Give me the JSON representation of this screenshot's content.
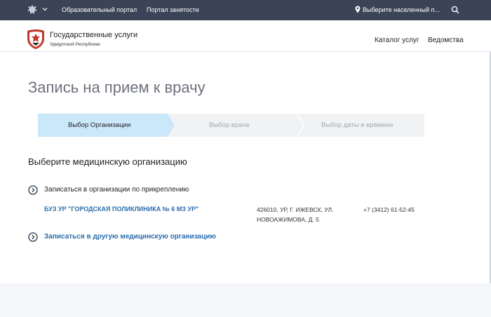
{
  "topbar": {
    "links": [
      "Образовательный портал",
      "Портал занятости"
    ],
    "location": "Выберите населенный п...",
    "icons": {
      "emblem": "coat-of-arms-icon",
      "location": "location-pin-icon",
      "search": "search-icon"
    }
  },
  "header": {
    "brand": "Государственные услуги",
    "region": "Удмуртской Республики",
    "nav": [
      "Каталог услуг",
      "Ведомства"
    ]
  },
  "page_title": "Запись на прием к врачу",
  "steps": [
    {
      "label": "Выбор Организации",
      "active": true
    },
    {
      "label": "Выбор врача",
      "active": false
    },
    {
      "label": "Выбор даты и времени",
      "active": false
    }
  ],
  "section_title": "Выберите медицинскую организацию",
  "attached": {
    "label": "Записаться в организации по прикреплению",
    "org": {
      "name": "БУЗ УР \"ГОРОДСКАЯ ПОЛИКЛИНИКА № 6 МЗ УР\"",
      "address_line1": "426010, УР, Г. ИЖЕВСК, УЛ.",
      "address_line2": "НОВОАЖИМОВА, Д. 5",
      "phone": "+7 (3412) 61-52-45"
    }
  },
  "other_org_label": "Записаться в другую медицинскую организацию",
  "colors": {
    "topbar": "#3b4356",
    "active_step": "#cbe7fa",
    "inactive_step": "#f1f2f4",
    "link": "#2b6dac",
    "footer": "#f4f6fa"
  }
}
